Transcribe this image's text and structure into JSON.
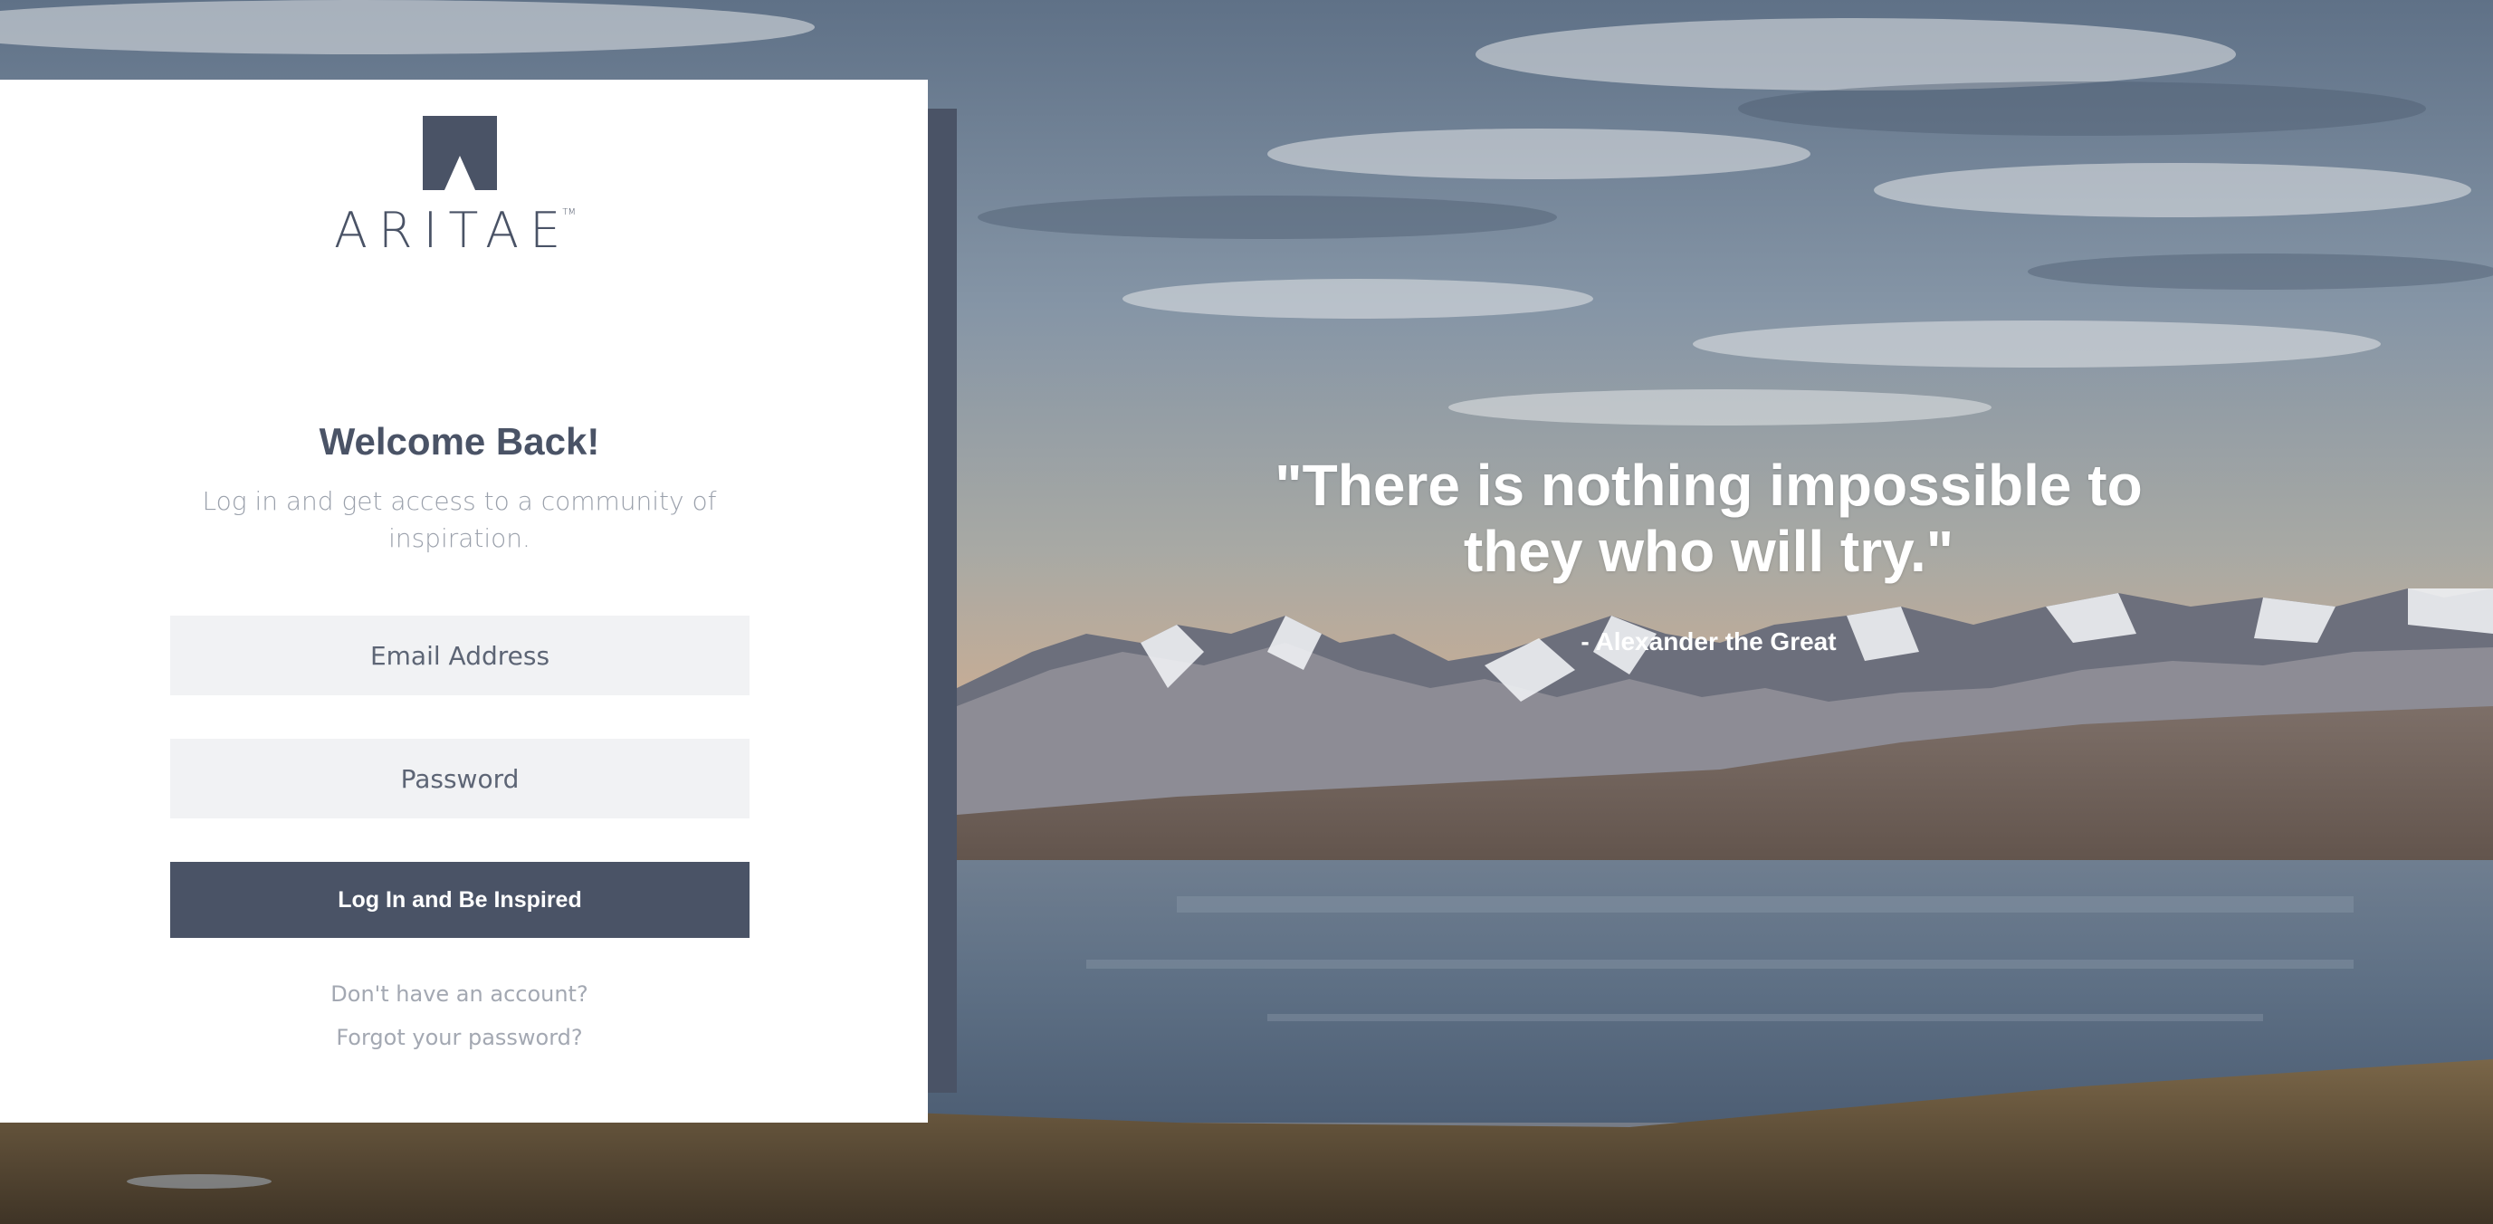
{
  "brand": {
    "name": "ARITAE",
    "trademark": "TM",
    "color": "#4a5366"
  },
  "login": {
    "heading": "Welcome Back!",
    "subtitle": "Log in and get access to a community of inspiration.",
    "email_placeholder": "Email Address",
    "password_placeholder": "Password",
    "submit_label": "Log In and Be Inspired",
    "signup_link": "Don't have an account?",
    "forgot_link": "Forgot your password?"
  },
  "quote": {
    "text": "\"There is nothing impossible to they who will try.\"",
    "author": "- Alexander the Great"
  },
  "background": {
    "scene": "mountain-lake-landscape"
  }
}
